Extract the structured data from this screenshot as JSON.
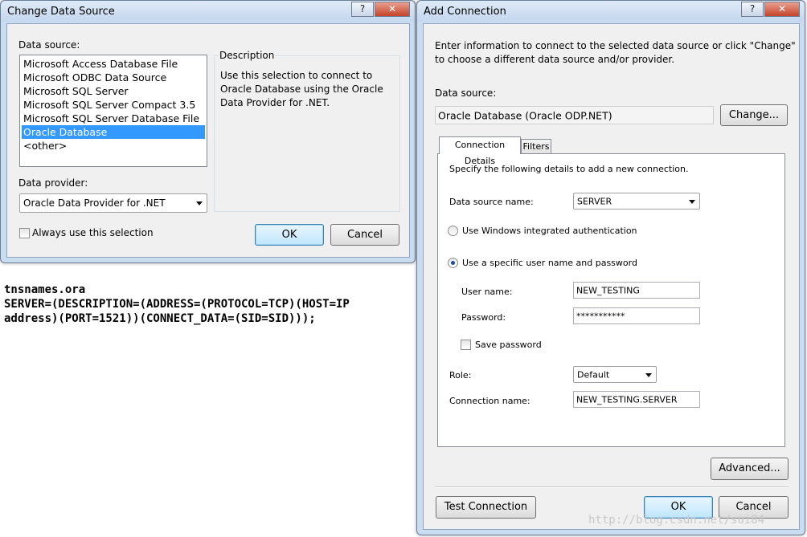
{
  "change_ds": {
    "title": "Change Data Source",
    "help": "?",
    "close": "✕",
    "ds_label": "Data source:",
    "items": [
      "Microsoft Access Database File",
      "Microsoft ODBC Data Source",
      "Microsoft SQL Server",
      "Microsoft SQL Server Compact 3.5",
      "Microsoft SQL Server Database File",
      "Oracle Database",
      "<other>"
    ],
    "selected_index": 5,
    "desc_label": "Description",
    "desc_text": [
      "Use this selection to connect to",
      "Oracle Database using the Oracle",
      "Data Provider for .NET."
    ],
    "provider_label": "Data provider:",
    "provider_value": "Oracle Data Provider for .NET",
    "always_label": "Always use this selection",
    "ok": "OK",
    "cancel": "Cancel"
  },
  "tnsnames": {
    "line1": "tnsnames.ora",
    "line2": "SERVER=(DESCRIPTION=(ADDRESS=(PROTOCOL=TCP)(HOST=IP",
    "line3": "address)(PORT=1521))(CONNECT_DATA=(SID=SID)));"
  },
  "add_conn": {
    "title": "Add Connection",
    "help": "?",
    "close": "✕",
    "intro": [
      "Enter information to connect to the selected data source or click \"Change\"",
      "to choose a different data source and/or provider."
    ],
    "ds_label": "Data source:",
    "ds_value": "Oracle Database (Oracle ODP.NET)",
    "change_btn": "Change...",
    "tab_details": "Connection Details",
    "tab_filters": "Filters",
    "specify": "Specify the following details to add a new connection.",
    "dsn_label": "Data source name:",
    "dsn_value": "SERVER",
    "win_auth": "Use Windows integrated authentication",
    "specific_user": "Use a specific user name and password",
    "user_label": "User name:",
    "user_value": "NEW_TESTING",
    "pass_label": "Password:",
    "pass_value": "***********",
    "save_pw": "Save password",
    "role_label": "Role:",
    "role_value": "Default",
    "conn_name_label": "Connection name:",
    "conn_name_value": "NEW_TESTING.SERVER",
    "advanced": "Advanced...",
    "test": "Test Connection",
    "ok": "OK",
    "cancel": "Cancel"
  },
  "watermark": "http://blog.csdn.net/sui84"
}
